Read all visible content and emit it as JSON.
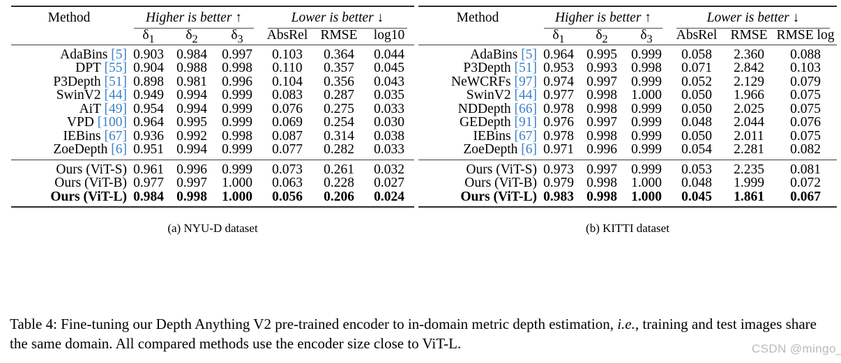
{
  "tables": [
    {
      "id": "nyu",
      "subcaption": "(a) NYU-D dataset",
      "header": {
        "method": "Method",
        "group_higher": "Higher is better ↑",
        "group_lower": "Lower is better ↓",
        "columns": [
          "δ",
          "δ",
          "δ",
          "AbsRel",
          "RMSE",
          "log10"
        ],
        "sub": [
          "1",
          "2",
          "3"
        ]
      },
      "rows": [
        {
          "method": "AdaBins",
          "cite": "[5]",
          "values": [
            "0.903",
            "0.984",
            "0.997",
            "0.103",
            "0.364",
            "0.044"
          ],
          "bold": false
        },
        {
          "method": "DPT",
          "cite": "[55]",
          "values": [
            "0.904",
            "0.988",
            "0.998",
            "0.110",
            "0.357",
            "0.045"
          ],
          "bold": false
        },
        {
          "method": "P3Depth",
          "cite": "[51]",
          "values": [
            "0.898",
            "0.981",
            "0.996",
            "0.104",
            "0.356",
            "0.043"
          ],
          "bold": false
        },
        {
          "method": "SwinV2",
          "cite": "[44]",
          "values": [
            "0.949",
            "0.994",
            "0.999",
            "0.083",
            "0.287",
            "0.035"
          ],
          "bold": false
        },
        {
          "method": "AiT",
          "cite": "[49]",
          "values": [
            "0.954",
            "0.994",
            "0.999",
            "0.076",
            "0.275",
            "0.033"
          ],
          "bold": false
        },
        {
          "method": "VPD",
          "cite": "[100]",
          "values": [
            "0.964",
            "0.995",
            "0.999",
            "0.069",
            "0.254",
            "0.030"
          ],
          "bold": false
        },
        {
          "method": "IEBins",
          "cite": "[67]",
          "values": [
            "0.936",
            "0.992",
            "0.998",
            "0.087",
            "0.314",
            "0.038"
          ],
          "bold": false
        },
        {
          "method": "ZoeDepth",
          "cite": "[6]",
          "values": [
            "0.951",
            "0.994",
            "0.999",
            "0.077",
            "0.282",
            "0.033"
          ],
          "bold": false
        }
      ],
      "ours": [
        {
          "method": "Ours (ViT-S)",
          "cite": "",
          "values": [
            "0.961",
            "0.996",
            "0.999",
            "0.073",
            "0.261",
            "0.032"
          ],
          "bold": false
        },
        {
          "method": "Ours (ViT-B)",
          "cite": "",
          "values": [
            "0.977",
            "0.997",
            "1.000",
            "0.063",
            "0.228",
            "0.027"
          ],
          "bold": false
        },
        {
          "method": "Ours (ViT-L)",
          "cite": "",
          "values": [
            "0.984",
            "0.998",
            "1.000",
            "0.056",
            "0.206",
            "0.024"
          ],
          "bold": true
        }
      ]
    },
    {
      "id": "kitti",
      "subcaption": "(b) KITTI dataset",
      "header": {
        "method": "Method",
        "group_higher": "Higher is better ↑",
        "group_lower": "Lower is better ↓",
        "columns": [
          "δ",
          "δ",
          "δ",
          "AbsRel",
          "RMSE",
          "RMSE log"
        ],
        "sub": [
          "1",
          "2",
          "3"
        ]
      },
      "rows": [
        {
          "method": "AdaBins",
          "cite": "[5]",
          "values": [
            "0.964",
            "0.995",
            "0.999",
            "0.058",
            "2.360",
            "0.088"
          ],
          "bold": false
        },
        {
          "method": "P3Depth",
          "cite": "[51]",
          "values": [
            "0.953",
            "0.993",
            "0.998",
            "0.071",
            "2.842",
            "0.103"
          ],
          "bold": false
        },
        {
          "method": "NeWCRFs",
          "cite": "[97]",
          "values": [
            "0.974",
            "0.997",
            "0.999",
            "0.052",
            "2.129",
            "0.079"
          ],
          "bold": false
        },
        {
          "method": "SwinV2",
          "cite": "[44]",
          "values": [
            "0.977",
            "0.998",
            "1.000",
            "0.050",
            "1.966",
            "0.075"
          ],
          "bold": false
        },
        {
          "method": "NDDepth",
          "cite": "[66]",
          "values": [
            "0.978",
            "0.998",
            "0.999",
            "0.050",
            "2.025",
            "0.075"
          ],
          "bold": false
        },
        {
          "method": "GEDepth",
          "cite": "[91]",
          "values": [
            "0.976",
            "0.997",
            "0.999",
            "0.048",
            "2.044",
            "0.076"
          ],
          "bold": false
        },
        {
          "method": "IEBins",
          "cite": "[67]",
          "values": [
            "0.978",
            "0.998",
            "0.999",
            "0.050",
            "2.011",
            "0.075"
          ],
          "bold": false
        },
        {
          "method": "ZoeDepth",
          "cite": "[6]",
          "values": [
            "0.971",
            "0.996",
            "0.999",
            "0.054",
            "2.281",
            "0.082"
          ],
          "bold": false
        }
      ],
      "ours": [
        {
          "method": "Ours (ViT-S)",
          "cite": "",
          "values": [
            "0.973",
            "0.997",
            "0.999",
            "0.053",
            "2.235",
            "0.081"
          ],
          "bold": false
        },
        {
          "method": "Ours (ViT-B)",
          "cite": "",
          "values": [
            "0.979",
            "0.998",
            "1.000",
            "0.048",
            "1.999",
            "0.072"
          ],
          "bold": false
        },
        {
          "method": "Ours (ViT-L)",
          "cite": "",
          "values": [
            "0.983",
            "0.998",
            "1.000",
            "0.045",
            "1.861",
            "0.067"
          ],
          "bold": true
        }
      ]
    }
  ],
  "caption": {
    "label": "Table 4:",
    "part1": " Fine-tuning our Depth Anything V2 pre-trained encoder to in-domain metric depth estimation, ",
    "italic": "i.e.",
    "part2": ", training and test images share the same domain. All compared methods use the encoder size close to ViT-L."
  },
  "watermark": "CSDN @mingo_敏"
}
